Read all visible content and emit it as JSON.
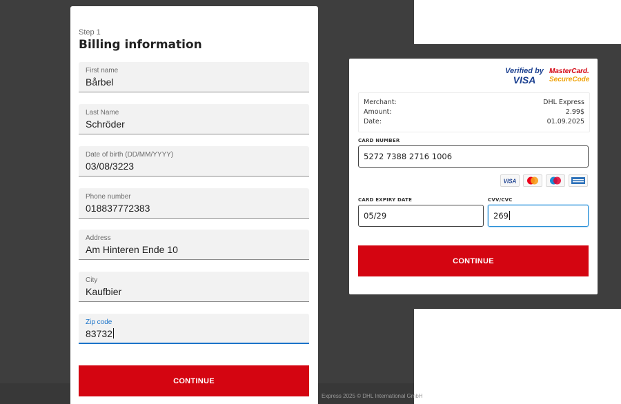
{
  "billing": {
    "step": "Step 1",
    "title": "Billing information",
    "fields": [
      {
        "label": "First name",
        "value": "Bårbel"
      },
      {
        "label": "Last Name",
        "value": "Schröder"
      },
      {
        "label": "Date of birth (DD/MM/YYYY)",
        "value": "03/08/3223"
      },
      {
        "label": "Phone number",
        "value": "018837772383"
      },
      {
        "label": "Address",
        "value": "Am Hinteren Ende 10"
      },
      {
        "label": "City",
        "value": "Kaufbier"
      },
      {
        "label": "Zip code",
        "value": "83732"
      }
    ],
    "continue_label": "CONTINUE",
    "accent_color": "#d40511",
    "focus_color": "#1a73c9"
  },
  "footer": {
    "text": "Express 2025 © DHL International GmbH"
  },
  "card_form": {
    "verified_by": "Verified by",
    "visa": "VISA",
    "mastercard": "MasterCard.",
    "securecode": "SecureCode",
    "merchant_label": "Merchant:",
    "merchant_value": "DHL Express",
    "amount_label": "Amount:",
    "amount_value": "2.99$",
    "date_label": "Date:",
    "date_value": "01.09.2025",
    "card_number_label": "CARD NUMBER",
    "card_number_value": "5272 7388 2716 1006",
    "expiry_label": "CARD EXPIRY DATE",
    "expiry_value": "05/29",
    "cvv_label": "CVV/CVC",
    "cvv_value": "269",
    "brands": [
      "visa-icon",
      "mastercard-icon",
      "maestro-icon",
      "amex-icon"
    ],
    "brand_visa_text": "VISA",
    "continue_label": "CONTINUE"
  }
}
